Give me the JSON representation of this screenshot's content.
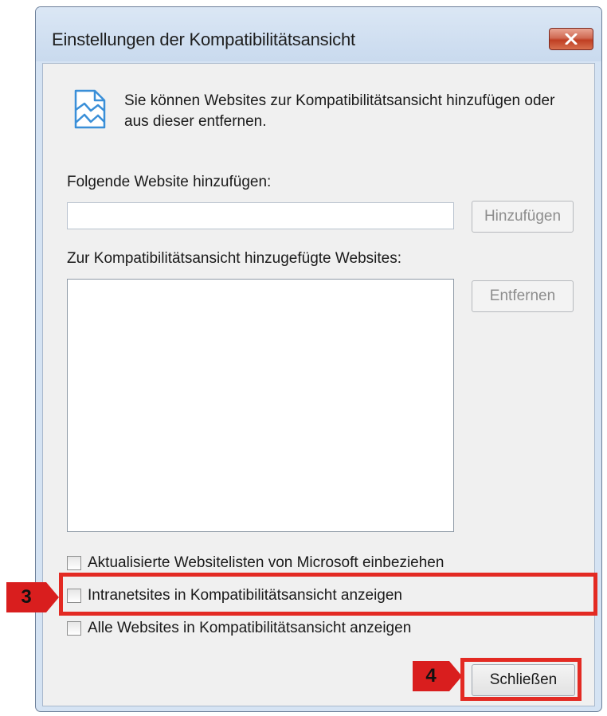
{
  "window": {
    "title": "Einstellungen der Kompatibilitätsansicht",
    "close_icon": "close-x-icon",
    "close_button_color": "#c8462a"
  },
  "intro": {
    "icon": "compatibility-view-icon",
    "text": "Sie können Websites zur Kompatibilitätsansicht hinzufügen oder aus dieser entfernen."
  },
  "add_site": {
    "label": "Folgende Website hinzufügen:",
    "value": "",
    "placeholder": "",
    "button_label": "Hinzufügen",
    "button_enabled": false
  },
  "site_list": {
    "label": "Zur Kompatibilitätsansicht hinzugefügte Websites:",
    "items": [],
    "remove_button_label": "Entfernen",
    "remove_button_enabled": false
  },
  "options": [
    {
      "label": "Aktualisierte Websitelisten von Microsoft einbeziehen",
      "checked": false
    },
    {
      "label": "Intranetsites in Kompatibilitätsansicht anzeigen",
      "checked": false
    },
    {
      "label": "Alle Websites in Kompatibilitätsansicht anzeigen",
      "checked": false
    }
  ],
  "close_button_label": "Schließen",
  "annotations": {
    "color": "#e32a23",
    "step_3": "3",
    "step_4": "4"
  }
}
